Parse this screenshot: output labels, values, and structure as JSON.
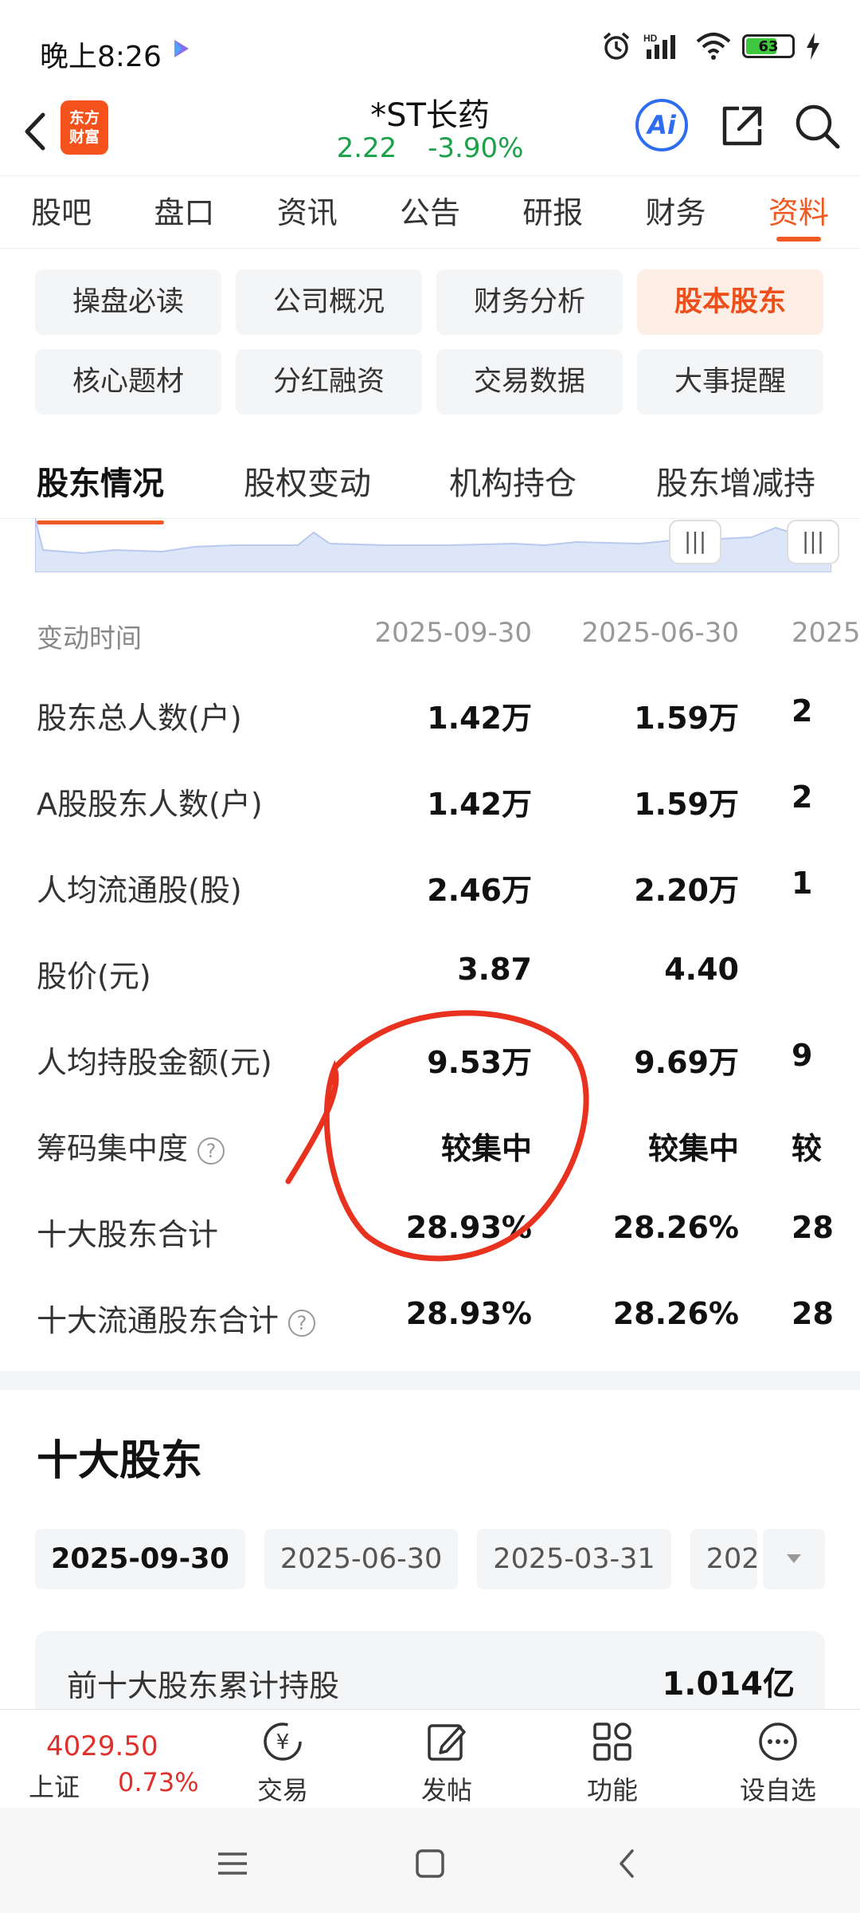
{
  "status_bar": {
    "time": "晚上8:26",
    "battery": "63",
    "network": "HD"
  },
  "header": {
    "logo_line1": "东方",
    "logo_line2": "财富",
    "stock_name": "*ST长药",
    "price": "2.22",
    "change_pct": "-3.90%",
    "ai_label": "Ai"
  },
  "tabs": [
    "股吧",
    "盘口",
    "资讯",
    "公告",
    "研报",
    "财务",
    "资料"
  ],
  "active_tab": "资料",
  "grid_buttons": [
    "操盘必读",
    "公司概况",
    "财务分析",
    "股本股东",
    "核心题材",
    "分红融资",
    "交易数据",
    "大事提醒"
  ],
  "sub_tabs": [
    "股东情况",
    "股权变动",
    "机构持仓",
    "股东增减持"
  ],
  "table": {
    "header": {
      "label": "变动时间",
      "c1": "2025-09-30",
      "c2": "2025-06-30",
      "c3": "2025"
    },
    "rows": [
      {
        "label": "股东总人数(户)",
        "c1": "1.42万",
        "c2": "1.59万",
        "c3": "2"
      },
      {
        "label": "A股股东人数(户)",
        "c1": "1.42万",
        "c2": "1.59万",
        "c3": "2"
      },
      {
        "label": "人均流通股(股)",
        "c1": "2.46万",
        "c2": "2.20万",
        "c3": "1"
      },
      {
        "label": "股价(元)",
        "c1": "3.87",
        "c2": "4.40",
        "c3": ""
      },
      {
        "label": "人均持股金额(元)",
        "c1": "9.53万",
        "c2": "9.69万",
        "c3": "9"
      },
      {
        "label": "筹码集中度",
        "c1": "较集中",
        "c2": "较集中",
        "c3": "较"
      },
      {
        "label": "十大股东合计",
        "c1": "28.93%",
        "c2": "28.26%",
        "c3": "28"
      },
      {
        "label": "十大流通股东合计",
        "c1": "28.93%",
        "c2": "28.26%",
        "c3": "28"
      }
    ]
  },
  "top_ten": {
    "title": "十大股东",
    "dates": [
      "2025-09-30",
      "2025-06-30",
      "2025-03-31",
      "202"
    ],
    "summary_label": "前十大股东累计持股",
    "summary_value": "1.014亿"
  },
  "bottom_bar": {
    "index_value": "4029.50",
    "index_name": "上证",
    "index_pct": "0.73%",
    "items": [
      "交易",
      "发帖",
      "功能",
      "设自选"
    ]
  },
  "colors": {
    "accent": "#f05a22",
    "down": "#1aa14a",
    "up": "#e0302b"
  }
}
